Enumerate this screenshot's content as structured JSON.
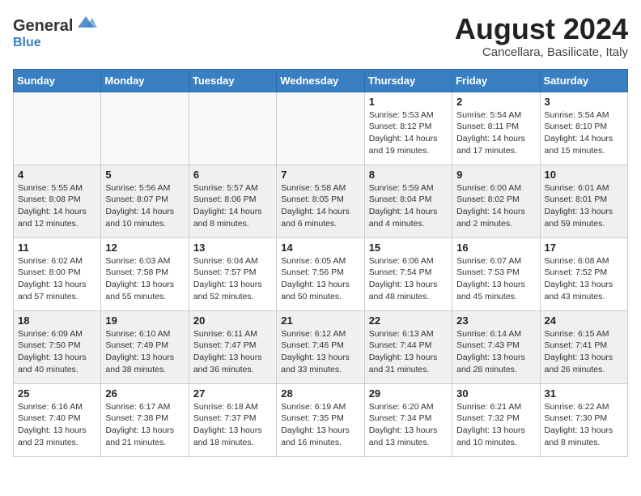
{
  "header": {
    "logo_general": "General",
    "logo_blue": "Blue",
    "month_title": "August 2024",
    "subtitle": "Cancellara, Basilicate, Italy"
  },
  "weekdays": [
    "Sunday",
    "Monday",
    "Tuesday",
    "Wednesday",
    "Thursday",
    "Friday",
    "Saturday"
  ],
  "weeks": [
    [
      {
        "day": "",
        "info": "",
        "empty": true
      },
      {
        "day": "",
        "info": "",
        "empty": true
      },
      {
        "day": "",
        "info": "",
        "empty": true
      },
      {
        "day": "",
        "info": "",
        "empty": true
      },
      {
        "day": "1",
        "info": "Sunrise: 5:53 AM\nSunset: 8:12 PM\nDaylight: 14 hours\nand 19 minutes."
      },
      {
        "day": "2",
        "info": "Sunrise: 5:54 AM\nSunset: 8:11 PM\nDaylight: 14 hours\nand 17 minutes."
      },
      {
        "day": "3",
        "info": "Sunrise: 5:54 AM\nSunset: 8:10 PM\nDaylight: 14 hours\nand 15 minutes."
      }
    ],
    [
      {
        "day": "4",
        "info": "Sunrise: 5:55 AM\nSunset: 8:08 PM\nDaylight: 14 hours\nand 12 minutes.",
        "gray": true
      },
      {
        "day": "5",
        "info": "Sunrise: 5:56 AM\nSunset: 8:07 PM\nDaylight: 14 hours\nand 10 minutes.",
        "gray": true
      },
      {
        "day": "6",
        "info": "Sunrise: 5:57 AM\nSunset: 8:06 PM\nDaylight: 14 hours\nand 8 minutes.",
        "gray": true
      },
      {
        "day": "7",
        "info": "Sunrise: 5:58 AM\nSunset: 8:05 PM\nDaylight: 14 hours\nand 6 minutes.",
        "gray": true
      },
      {
        "day": "8",
        "info": "Sunrise: 5:59 AM\nSunset: 8:04 PM\nDaylight: 14 hours\nand 4 minutes.",
        "gray": true
      },
      {
        "day": "9",
        "info": "Sunrise: 6:00 AM\nSunset: 8:02 PM\nDaylight: 14 hours\nand 2 minutes.",
        "gray": true
      },
      {
        "day": "10",
        "info": "Sunrise: 6:01 AM\nSunset: 8:01 PM\nDaylight: 13 hours\nand 59 minutes.",
        "gray": true
      }
    ],
    [
      {
        "day": "11",
        "info": "Sunrise: 6:02 AM\nSunset: 8:00 PM\nDaylight: 13 hours\nand 57 minutes."
      },
      {
        "day": "12",
        "info": "Sunrise: 6:03 AM\nSunset: 7:58 PM\nDaylight: 13 hours\nand 55 minutes."
      },
      {
        "day": "13",
        "info": "Sunrise: 6:04 AM\nSunset: 7:57 PM\nDaylight: 13 hours\nand 52 minutes."
      },
      {
        "day": "14",
        "info": "Sunrise: 6:05 AM\nSunset: 7:56 PM\nDaylight: 13 hours\nand 50 minutes."
      },
      {
        "day": "15",
        "info": "Sunrise: 6:06 AM\nSunset: 7:54 PM\nDaylight: 13 hours\nand 48 minutes."
      },
      {
        "day": "16",
        "info": "Sunrise: 6:07 AM\nSunset: 7:53 PM\nDaylight: 13 hours\nand 45 minutes."
      },
      {
        "day": "17",
        "info": "Sunrise: 6:08 AM\nSunset: 7:52 PM\nDaylight: 13 hours\nand 43 minutes."
      }
    ],
    [
      {
        "day": "18",
        "info": "Sunrise: 6:09 AM\nSunset: 7:50 PM\nDaylight: 13 hours\nand 40 minutes.",
        "gray": true
      },
      {
        "day": "19",
        "info": "Sunrise: 6:10 AM\nSunset: 7:49 PM\nDaylight: 13 hours\nand 38 minutes.",
        "gray": true
      },
      {
        "day": "20",
        "info": "Sunrise: 6:11 AM\nSunset: 7:47 PM\nDaylight: 13 hours\nand 36 minutes.",
        "gray": true
      },
      {
        "day": "21",
        "info": "Sunrise: 6:12 AM\nSunset: 7:46 PM\nDaylight: 13 hours\nand 33 minutes.",
        "gray": true
      },
      {
        "day": "22",
        "info": "Sunrise: 6:13 AM\nSunset: 7:44 PM\nDaylight: 13 hours\nand 31 minutes.",
        "gray": true
      },
      {
        "day": "23",
        "info": "Sunrise: 6:14 AM\nSunset: 7:43 PM\nDaylight: 13 hours\nand 28 minutes.",
        "gray": true
      },
      {
        "day": "24",
        "info": "Sunrise: 6:15 AM\nSunset: 7:41 PM\nDaylight: 13 hours\nand 26 minutes.",
        "gray": true
      }
    ],
    [
      {
        "day": "25",
        "info": "Sunrise: 6:16 AM\nSunset: 7:40 PM\nDaylight: 13 hours\nand 23 minutes."
      },
      {
        "day": "26",
        "info": "Sunrise: 6:17 AM\nSunset: 7:38 PM\nDaylight: 13 hours\nand 21 minutes."
      },
      {
        "day": "27",
        "info": "Sunrise: 6:18 AM\nSunset: 7:37 PM\nDaylight: 13 hours\nand 18 minutes."
      },
      {
        "day": "28",
        "info": "Sunrise: 6:19 AM\nSunset: 7:35 PM\nDaylight: 13 hours\nand 16 minutes."
      },
      {
        "day": "29",
        "info": "Sunrise: 6:20 AM\nSunset: 7:34 PM\nDaylight: 13 hours\nand 13 minutes."
      },
      {
        "day": "30",
        "info": "Sunrise: 6:21 AM\nSunset: 7:32 PM\nDaylight: 13 hours\nand 10 minutes."
      },
      {
        "day": "31",
        "info": "Sunrise: 6:22 AM\nSunset: 7:30 PM\nDaylight: 13 hours\nand 8 minutes."
      }
    ]
  ]
}
